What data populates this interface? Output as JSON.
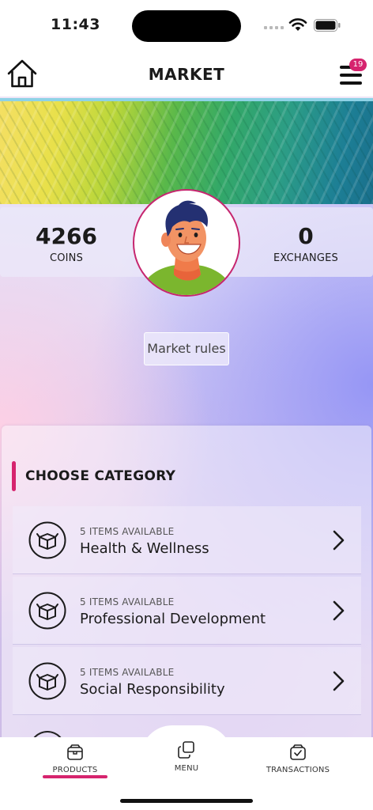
{
  "status_bar": {
    "time": "11:43"
  },
  "header": {
    "title": "MARKET",
    "notification_count": "19"
  },
  "stats": {
    "coins_value": "4266",
    "coins_label": "COINS",
    "exchanges_value": "0",
    "exchanges_label": "EXCHANGES"
  },
  "market_rules_label": "Market rules",
  "categories": {
    "title": "CHOOSE CATEGORY",
    "items": [
      {
        "availability": "5 ITEMS AVAILABLE",
        "name": "Health & Wellness"
      },
      {
        "availability": "5 ITEMS AVAILABLE",
        "name": "Professional Development"
      },
      {
        "availability": "5 ITEMS AVAILABLE",
        "name": "Social Responsibility"
      }
    ]
  },
  "bottom_nav": {
    "items": [
      {
        "label": "PRODUCTS",
        "icon": "box-icon",
        "active": true
      },
      {
        "label": "MENU",
        "icon": "copy-icon",
        "active": false
      },
      {
        "label": "TRANSACTIONS",
        "icon": "checked-box-icon",
        "active": false
      }
    ]
  },
  "colors": {
    "accent": "#d6246e",
    "avatar_border": "#c6266f",
    "banner_top_border": "#8ed2e6"
  }
}
